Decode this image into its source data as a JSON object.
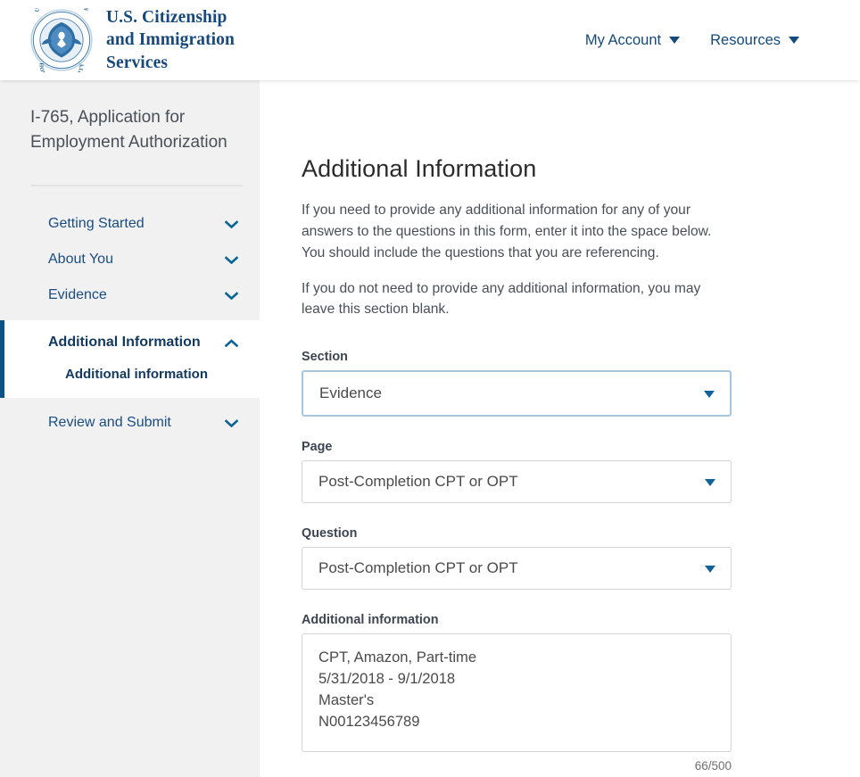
{
  "header": {
    "seal_icon": "dhs-seal-icon",
    "brand": "U.S. Citizenship\nand Immigration\nServices",
    "nav": [
      {
        "label": "My Account",
        "icon": "chevron-down-icon"
      },
      {
        "label": "Resources",
        "icon": "chevron-down-icon"
      }
    ]
  },
  "sidebar": {
    "form_title": "I-765, Application for Employment Authorization",
    "items": [
      {
        "label": "Getting Started",
        "icon": "chevron-down-icon",
        "expanded": false
      },
      {
        "label": "About You",
        "icon": "chevron-down-icon",
        "expanded": false
      },
      {
        "label": "Evidence",
        "icon": "chevron-down-icon",
        "expanded": false
      },
      {
        "label": "Additional Information",
        "icon": "chevron-up-icon",
        "expanded": true,
        "sub": "Additional information"
      },
      {
        "label": "Review and Submit",
        "icon": "chevron-down-icon",
        "expanded": false
      }
    ]
  },
  "main": {
    "title": "Additional Information",
    "paragraph_1": "If you need to provide any additional information for any of your answers to the questions in this form, enter it into the space below. You should include the questions that you are referencing.",
    "paragraph_2": "If you do not need to provide any additional information, you may leave this section blank.",
    "fields": {
      "section": {
        "label": "Section",
        "value": "Evidence",
        "icon": "caret-down-icon"
      },
      "page": {
        "label": "Page",
        "value": "Post-Completion CPT or OPT",
        "icon": "caret-down-icon"
      },
      "question": {
        "label": "Question",
        "value": "Post-Completion CPT or OPT",
        "icon": "caret-down-icon"
      },
      "additional_information": {
        "label": "Additional information",
        "value": "CPT, Amazon, Part-time\n5/31/2018 - 9/1/2018\nMaster's\nN00123456789",
        "char_count": "66/500"
      }
    }
  },
  "colors": {
    "brand_blue": "#17497d",
    "link_blue": "#1a4d80",
    "active_border": "#0b5288",
    "caret_blue": "#10639a",
    "focus_ring": "#a7c6da",
    "sidebar_bg": "#f1f1f1"
  }
}
